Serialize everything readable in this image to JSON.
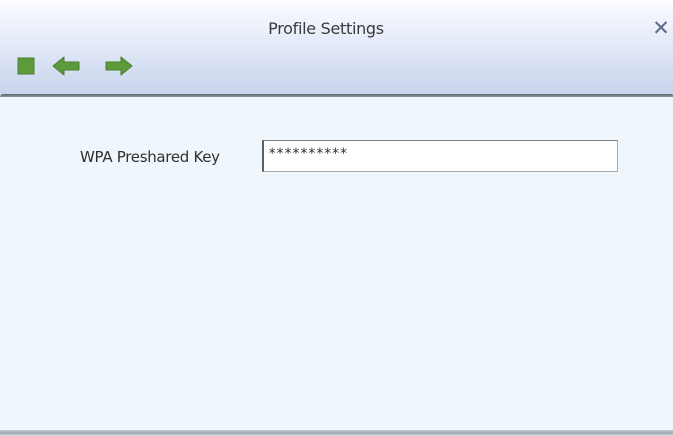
{
  "window": {
    "title": "Profile Settings",
    "close_symbol": "✕"
  },
  "toolbar": {
    "buttons": [
      {
        "icon": "stop-icon",
        "color": "#5d9a3c"
      },
      {
        "icon": "arrow-left-icon",
        "color": "#5d9a3c"
      },
      {
        "icon": "arrow-right-icon",
        "color": "#5d9a3c"
      }
    ]
  },
  "form": {
    "wpa_key": {
      "label": "WPA Preshared Key",
      "value": "**********"
    }
  },
  "colors": {
    "accent_green": "#5d9a3c",
    "content_background": "#eff7fd",
    "header_gradient_end": "#c9d5ee"
  }
}
